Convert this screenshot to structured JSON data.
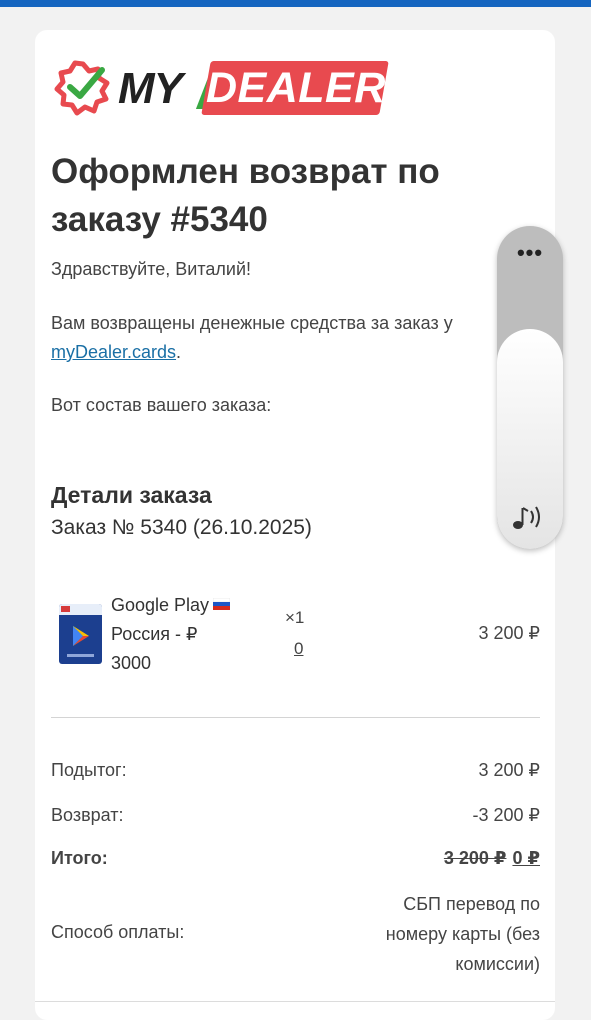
{
  "brand": {
    "logo_my": "MY",
    "logo_slash": "/",
    "logo_dealer": "DEALER",
    "accent_red": "#e84a4f",
    "accent_green": "#3aa843",
    "top_bar": "#1565c0"
  },
  "title": "Оформлен возврат по заказу #5340",
  "greeting": "Здравствуйте, Виталий!",
  "refund_text": "Вам возвращены денежные средства за заказ у",
  "site_link": "myDealer.cards",
  "period": ".",
  "order_intro": "Вот состав вашего заказа:",
  "details_heading": "Детали заказа",
  "order_number": "Заказ № 5340 (26.10.2025)",
  "item": {
    "name": "Google Play",
    "region": "Россия - ₽",
    "amount": "3000",
    "qty_label": "×1",
    "qty_value": "0",
    "price": "3 200 ₽",
    "flag_icon": "russia-flag-icon"
  },
  "summary": {
    "subtotal_label": "Подытог:",
    "subtotal_value": "3 200 ₽",
    "refund_label": "Возврат:",
    "refund_value": "-3 200 ₽",
    "total_label": "Итого:",
    "total_old": "3 200 ₽",
    "total_new": "0 ₽",
    "payment_label": "Способ оплаты:",
    "payment_value": "СБП перевод по номеру карты (без комиссии)"
  },
  "floater": {
    "menu_icon": "more-dots-icon",
    "dots": "•••",
    "sound_icon": "sound-note-icon"
  }
}
